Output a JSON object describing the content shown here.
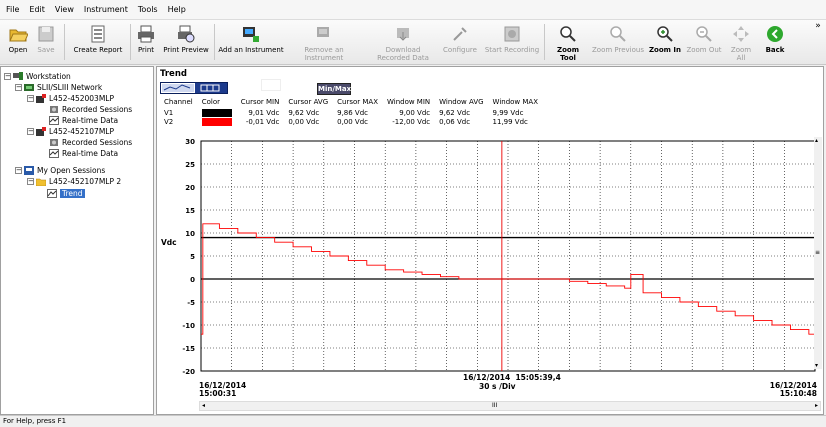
{
  "menu": [
    "File",
    "Edit",
    "View",
    "Instrument",
    "Tools",
    "Help"
  ],
  "toolbar": {
    "open": "Open",
    "save": "Save",
    "create_report": "Create Report",
    "print": "Print",
    "print_preview": "Print Preview",
    "add_instrument": "Add an Instrument",
    "remove_instrument": "Remove an Instrument",
    "download": "Download Recorded Data",
    "configure": "Configure",
    "start_recording": "Start Recording",
    "zoom_tool": "Zoom Tool",
    "zoom_previous": "Zoom Previous",
    "zoom_in": "Zoom In",
    "zoom_out": "Zoom Out",
    "zoom_all": "Zoom All",
    "back": "Back",
    "overflow": "»"
  },
  "tree": {
    "workstation": "Workstation",
    "network": "SLII/SLIII Network",
    "inst1": "L452-452003MLP",
    "rec1": "Recorded Sessions",
    "rt1": "Real-time Data",
    "inst2": "L452-452107MLP",
    "rec2": "Recorded Sessions",
    "rt2": "Real-time Data",
    "open_sessions": "My Open Sessions",
    "session": "L452-452107MLP 2",
    "trend": "Trend"
  },
  "trend": {
    "title": "Trend",
    "minmax_button": "Min/Max",
    "columns": [
      "Channel",
      "Color",
      "Cursor MIN",
      "Cursor AVG",
      "Cursor MAX",
      "Window MIN",
      "Window AVG",
      "Window MAX"
    ],
    "rows": [
      {
        "channel": "V1",
        "color": "#000000",
        "cursor_min": "9,01 Vdc",
        "cursor_avg": "9,62 Vdc",
        "cursor_max": "9,86 Vdc",
        "window_min": "9,00 Vdc",
        "window_avg": "9,62 Vdc",
        "window_max": "9,99 Vdc"
      },
      {
        "channel": "V2",
        "color": "#ff0000",
        "cursor_min": "-0,01 Vdc",
        "cursor_avg": "0,00 Vdc",
        "cursor_max": "0,00 Vdc",
        "window_min": "-12,00 Vdc",
        "window_avg": "0,06 Vdc",
        "window_max": "11,99 Vdc"
      }
    ],
    "ylabel": "Vdc",
    "start_date": "16/12/2014",
    "start_time": "15:00:31",
    "end_date": "16/12/2014",
    "end_time": "15:10:48",
    "cursor_label": "16/12/2014  15:05:39,4",
    "timebase": "30 s /Div",
    "scroll_grip": "III"
  },
  "chart_data": {
    "type": "line",
    "ylabel": "Vdc",
    "ylim": [
      -20,
      30
    ],
    "yticks": [
      30,
      25,
      20,
      15,
      10,
      5,
      0,
      -5,
      -10,
      -15,
      -20
    ],
    "grid": true,
    "cursor_fraction": 0.49,
    "series": [
      {
        "name": "V1",
        "color": "#000000",
        "x": [
          0,
          1
        ],
        "values": [
          9.0,
          9.0
        ]
      },
      {
        "name": "V2",
        "color": "#ff0000",
        "x": [
          0,
          0.003,
          0.006,
          0.03,
          0.06,
          0.09,
          0.12,
          0.15,
          0.18,
          0.21,
          0.24,
          0.27,
          0.3,
          0.33,
          0.36,
          0.39,
          0.42,
          0.45,
          0.48,
          0.51,
          0.54,
          0.57,
          0.6,
          0.63,
          0.66,
          0.69,
          0.7,
          0.72,
          0.75,
          0.78,
          0.81,
          0.84,
          0.87,
          0.9,
          0.93,
          0.96,
          0.99,
          1.0
        ],
        "values": [
          -12,
          12,
          12,
          11,
          10,
          9,
          8,
          7,
          6,
          5,
          4,
          3,
          2,
          1.5,
          1,
          0.5,
          0,
          0,
          0,
          0,
          0,
          0,
          -0.5,
          -1,
          -1.5,
          -2,
          1,
          -3,
          -4,
          -5,
          -6,
          -7,
          -8,
          -9,
          -10,
          -11,
          -12,
          -12
        ]
      }
    ]
  },
  "status": "For Help, press F1"
}
